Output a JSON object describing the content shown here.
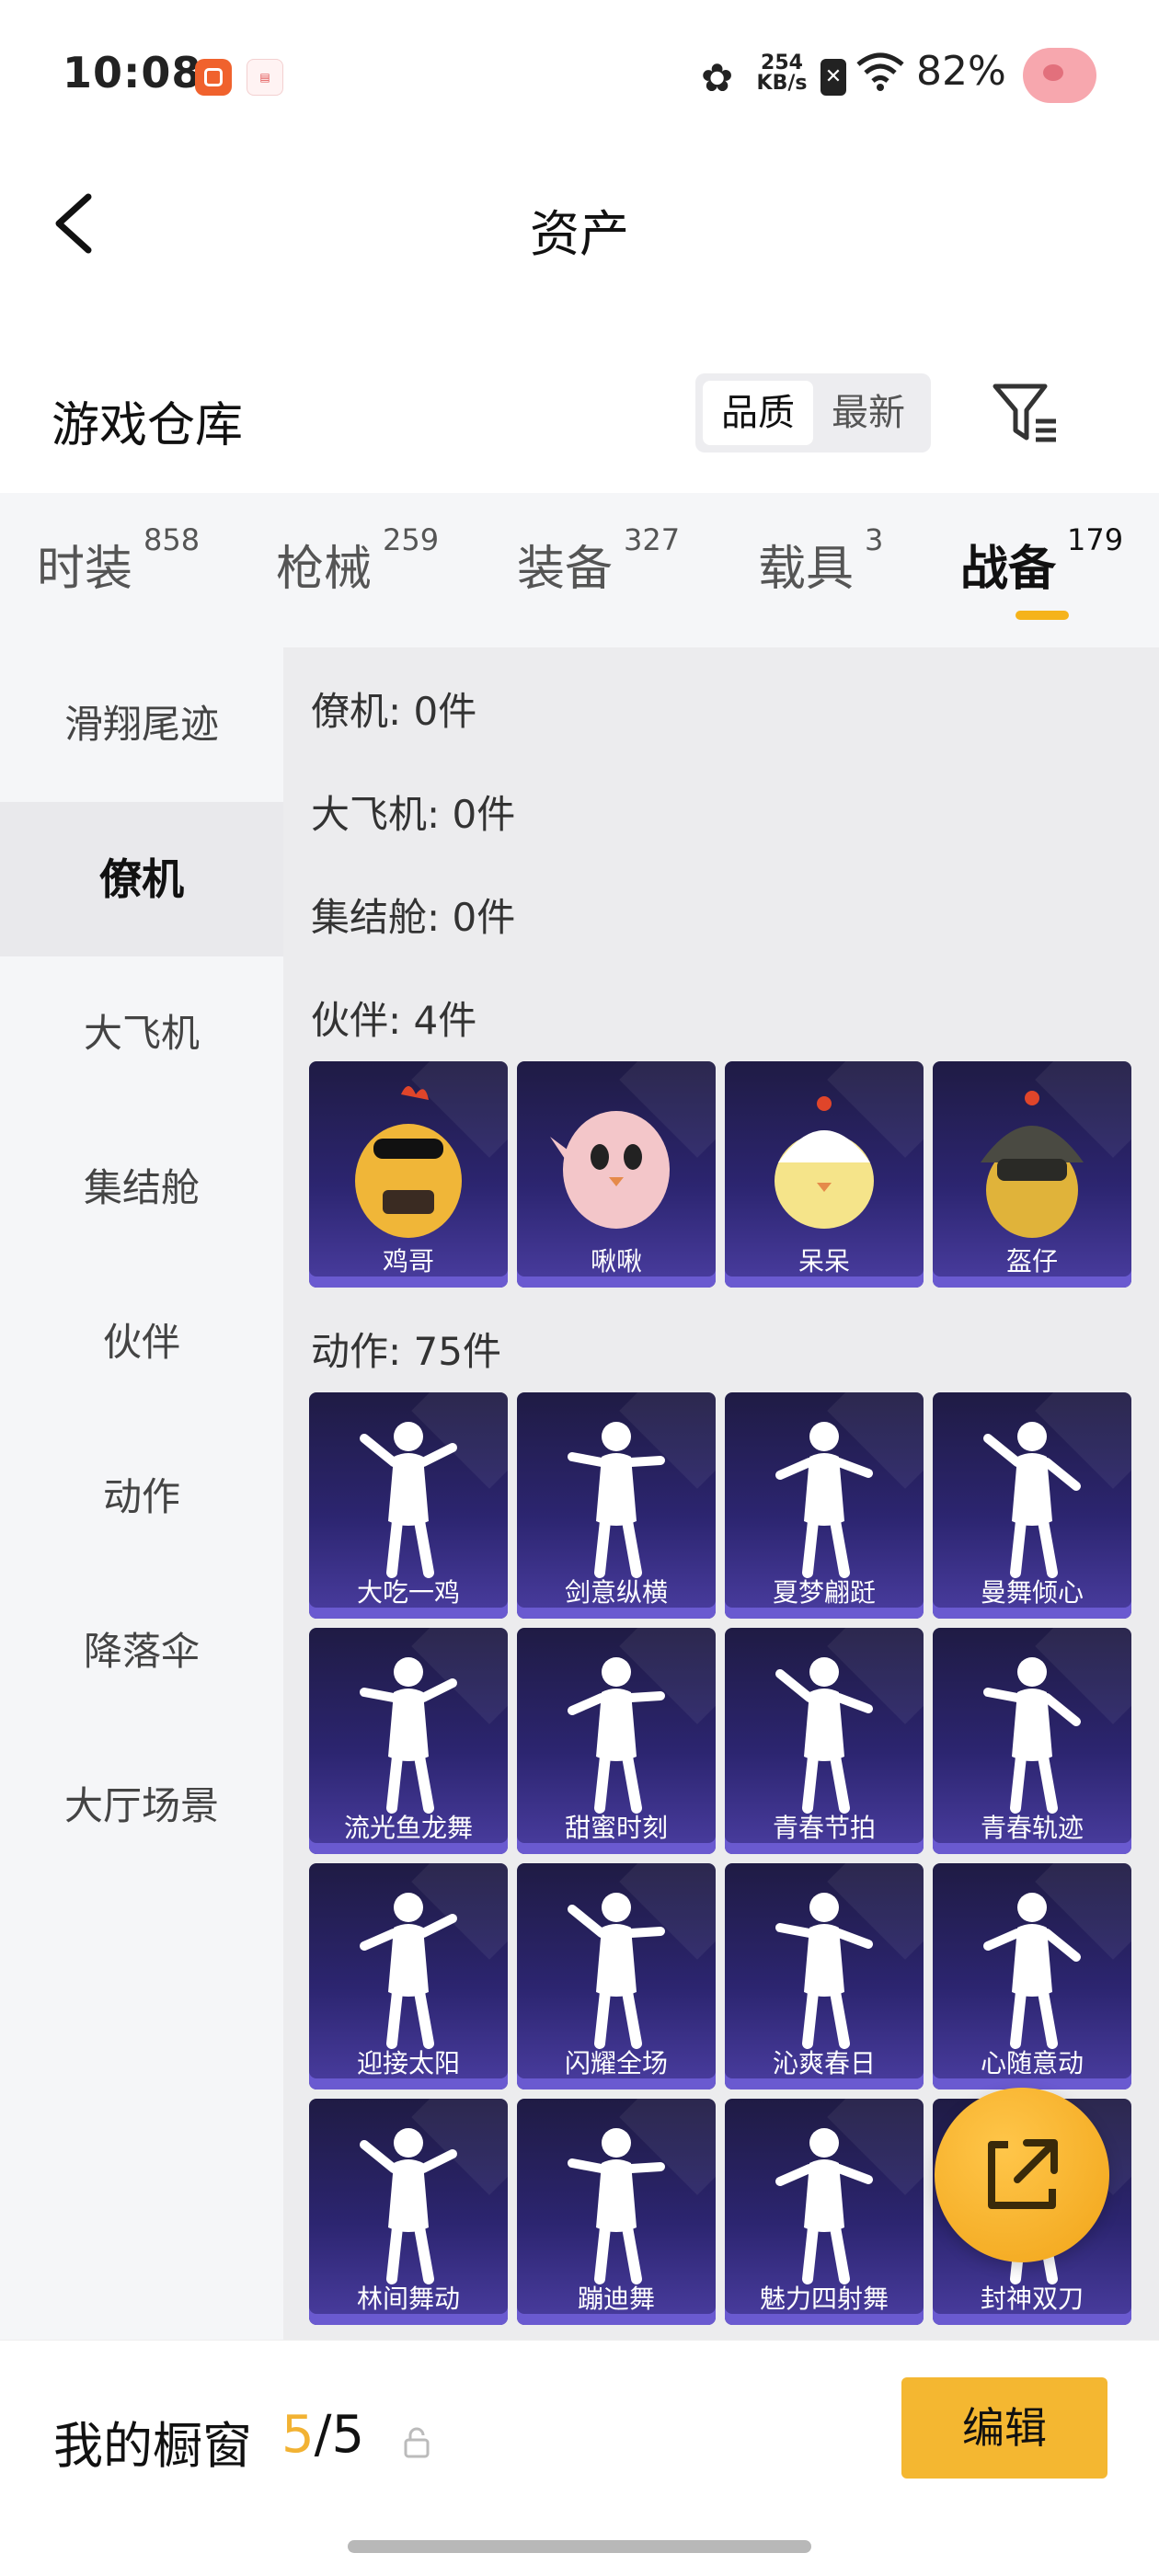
{
  "status_bar": {
    "time": "10:08",
    "speed_value": "254",
    "speed_unit": "KB/s",
    "battery": "82%"
  },
  "header": {
    "title": "资产"
  },
  "warehouse": {
    "title": "游戏仓库",
    "sort_options": [
      "品质",
      "最新"
    ],
    "active_sort": "品质"
  },
  "tabs": [
    {
      "label": "时装",
      "count": "858"
    },
    {
      "label": "枪械",
      "count": "259"
    },
    {
      "label": "装备",
      "count": "327"
    },
    {
      "label": "载具",
      "count": "3"
    },
    {
      "label": "战备",
      "count": "179",
      "active": true
    }
  ],
  "sidebar": {
    "items": [
      "滑翔尾迹",
      "僚机",
      "大飞机",
      "集结舱",
      "伙伴",
      "动作",
      "降落伞",
      "大厅场景"
    ],
    "active": "僚机"
  },
  "content": {
    "categories": [
      {
        "label": "僚机: 0件"
      },
      {
        "label": "大飞机: 0件"
      },
      {
        "label": "集结舱: 0件"
      },
      {
        "label": "伙伴: 4件"
      },
      {
        "label": "动作: 75件"
      }
    ],
    "partners": [
      "鸡哥",
      "啾啾",
      "呆呆",
      "盔仔"
    ],
    "actions": [
      "大吃一鸡",
      "剑意纵横",
      "夏梦翩跹",
      "曼舞倾心",
      "流光鱼龙舞",
      "甜蜜时刻",
      "青春节拍",
      "青春轨迹",
      "迎接太阳",
      "闪耀全场",
      "沁爽春日",
      "心随意动",
      "林间舞动",
      "蹦迪舞",
      "魅力四射舞",
      "封神双刀"
    ]
  },
  "bottom": {
    "showcase_label": "我的橱窗",
    "showcase_current": "5",
    "showcase_total": "/5",
    "edit_label": "编辑"
  },
  "colors": {
    "accent": "#f5b31b",
    "card_bg": "#2c2570",
    "edit_button": "#f4b731"
  }
}
